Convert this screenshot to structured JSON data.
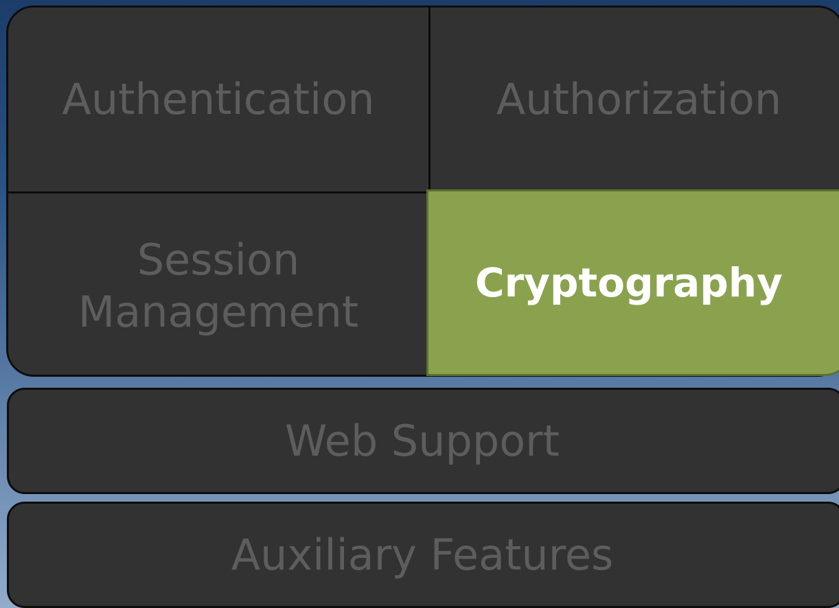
{
  "diagram": {
    "cells": {
      "authentication": "Authentication",
      "authorization": "Authorization",
      "session_line1": "Session",
      "session_line2": "Management",
      "cryptography": "Cryptography"
    },
    "bars": {
      "web_support": "Web Support",
      "auxiliary_features": "Auxiliary Features"
    },
    "colors": {
      "background_top": "#1c3d6a",
      "background_bottom": "#93accb",
      "block_fill": "#323232",
      "dim_text": "#5d5d5d",
      "highlight_fill": "#8aa24e",
      "highlight_text": "#ffffff"
    }
  }
}
